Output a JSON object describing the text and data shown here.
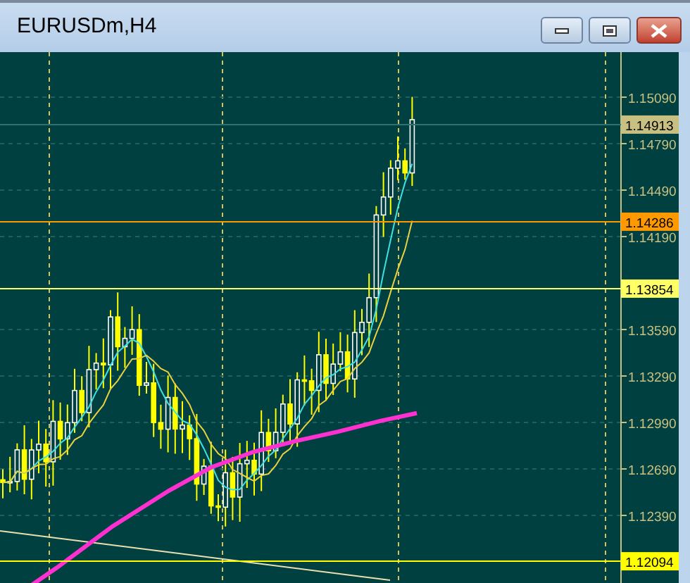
{
  "window": {
    "title": "EURUSDm,H4"
  },
  "chart": {
    "price_ticks": [
      "1.15090",
      "1.14790",
      "1.14490",
      "1.14190",
      "1.13590",
      "1.13290",
      "1.12990",
      "1.12690",
      "1.12390"
    ],
    "price_lines": [
      {
        "kind": "bid",
        "label": "1.14913",
        "color": "#c8c080"
      },
      {
        "kind": "level",
        "label": "1.14286",
        "color": "#ff9900"
      },
      {
        "kind": "level",
        "label": "1.13854",
        "color": "#ffff66"
      },
      {
        "kind": "level",
        "label": "1.12094",
        "color": "#ffff00"
      }
    ]
  }
}
